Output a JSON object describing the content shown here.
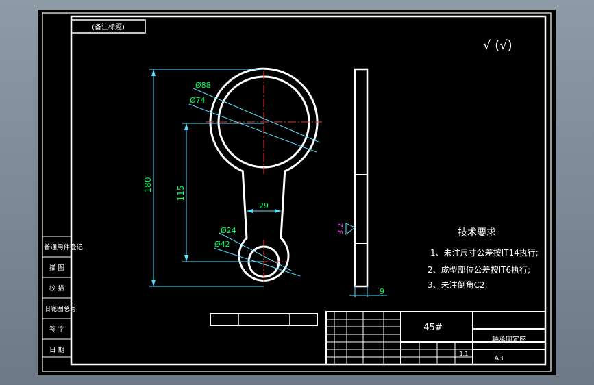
{
  "colors": {
    "background": "#000000",
    "outline": "#ffffff",
    "dimension": "#00ff66",
    "extension": "#55e0ff",
    "centerline": "#ff2a2a",
    "roughness_symbol": "#ff44ff"
  },
  "title_tag": "(备注标题)",
  "roughness_marks": "√ (√)",
  "dimensions": {
    "outer_large_dia": "Ø88",
    "inner_large_dia": "Ø74",
    "overall_length": "180",
    "center_distance": "115",
    "neck_width": "29",
    "inner_small_dia": "Ø24",
    "outer_small_dia": "Ø42",
    "thickness": "9",
    "side_roughness": "3.2"
  },
  "tech_requirements": {
    "title": "技术要求",
    "items": [
      "1、未注尺寸公差按IT14执行;",
      "2、成型部位公差按IT6执行;",
      "3、未注倒角C2;"
    ]
  },
  "left_table": [
    "普通用件登记",
    "描 图",
    "校 描",
    "旧底图总号",
    "签 字",
    "日 期"
  ],
  "title_block": {
    "material": "45#",
    "part_name": "轴承固定座",
    "sheet_size": "A3",
    "scale": "1:1"
  }
}
